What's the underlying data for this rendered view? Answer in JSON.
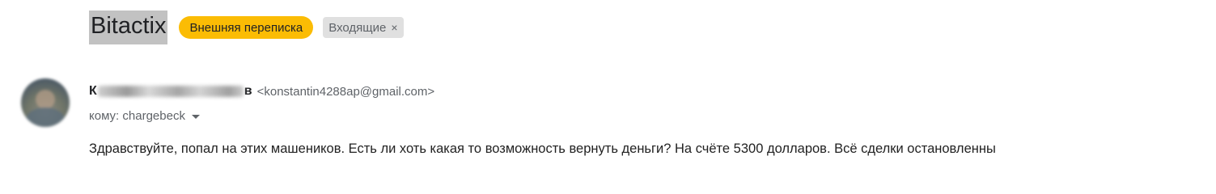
{
  "header": {
    "subject": "Bitactix",
    "labels": [
      {
        "text": "Внешняя переписка",
        "color": "#fbbc04"
      },
      {
        "text": "Входящие",
        "close_symbol": "×",
        "color": "#e0e0e0"
      }
    ]
  },
  "message": {
    "sender": {
      "name_visible_start": "К",
      "name_visible_end": "в",
      "email": "<konstantin4288ap@gmail.com>"
    },
    "recipient": {
      "text": "кому: chargebeck"
    },
    "body": "Здравствуйте, попал на этих машеников. Есть ли хоть какая то возможность вернуть деньги? На счёте 5300 долларов. Всё сделки остановленны"
  }
}
